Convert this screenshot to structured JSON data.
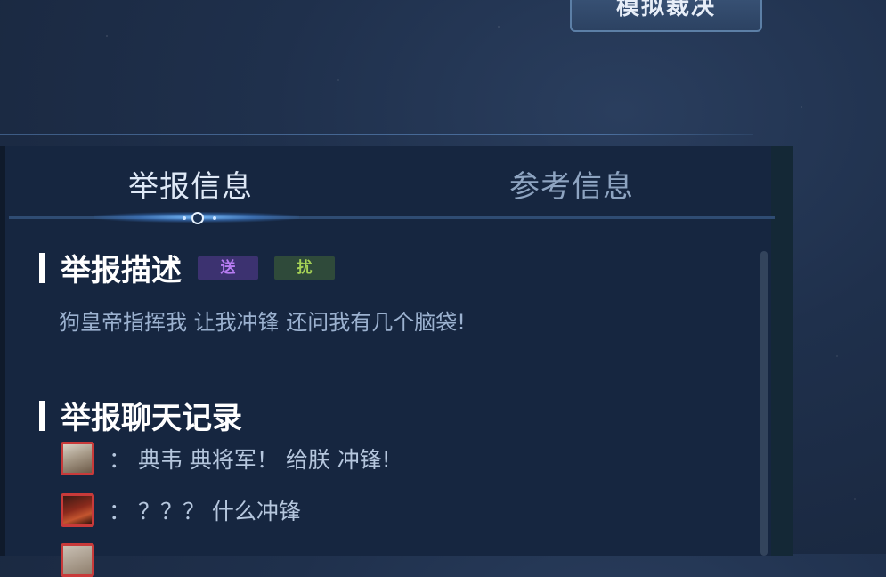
{
  "top_button": {
    "label": "模拟裁决"
  },
  "tabs": [
    {
      "label": "举报信息",
      "active": true
    },
    {
      "label": "参考信息",
      "active": false
    }
  ],
  "report_description": {
    "title": "举报描述",
    "tags": [
      {
        "label": "送",
        "color": "#b77cf2"
      },
      {
        "label": "扰",
        "color": "#a6d256"
      }
    ],
    "text": "狗皇帝指挥我 让我冲锋 还问我有几个脑袋!"
  },
  "chat_log": {
    "title": "举报聊天记录",
    "messages": [
      {
        "avatar": "hero-avatar-1",
        "text": "： 典韦 典将军！ 给朕 冲锋!"
      },
      {
        "avatar": "hero-avatar-2",
        "text": "： ？？？ 什么冲锋"
      },
      {
        "avatar": "hero-avatar-1",
        "text": ""
      }
    ]
  },
  "colors": {
    "accent": "#6fb4ff",
    "avatar_border": "#c83a3a"
  }
}
